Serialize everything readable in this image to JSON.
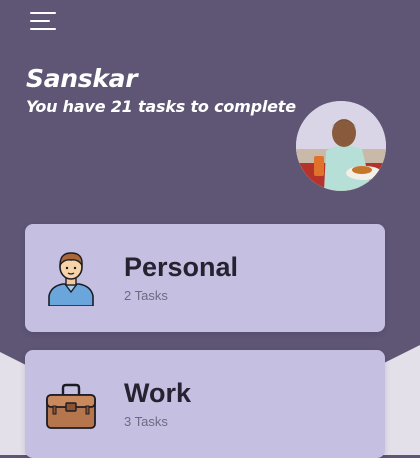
{
  "header": {
    "user_name": "Sanskar",
    "task_summary": "You have 21 tasks to complete"
  },
  "categories": [
    {
      "title": "Personal",
      "count_label": "2 Tasks",
      "icon": "person-icon"
    },
    {
      "title": "Work",
      "count_label": "3 Tasks",
      "icon": "briefcase-icon"
    }
  ],
  "colors": {
    "background": "#5f5676",
    "card": "#c5bfe1",
    "lower_background": "#e3e0ea"
  }
}
